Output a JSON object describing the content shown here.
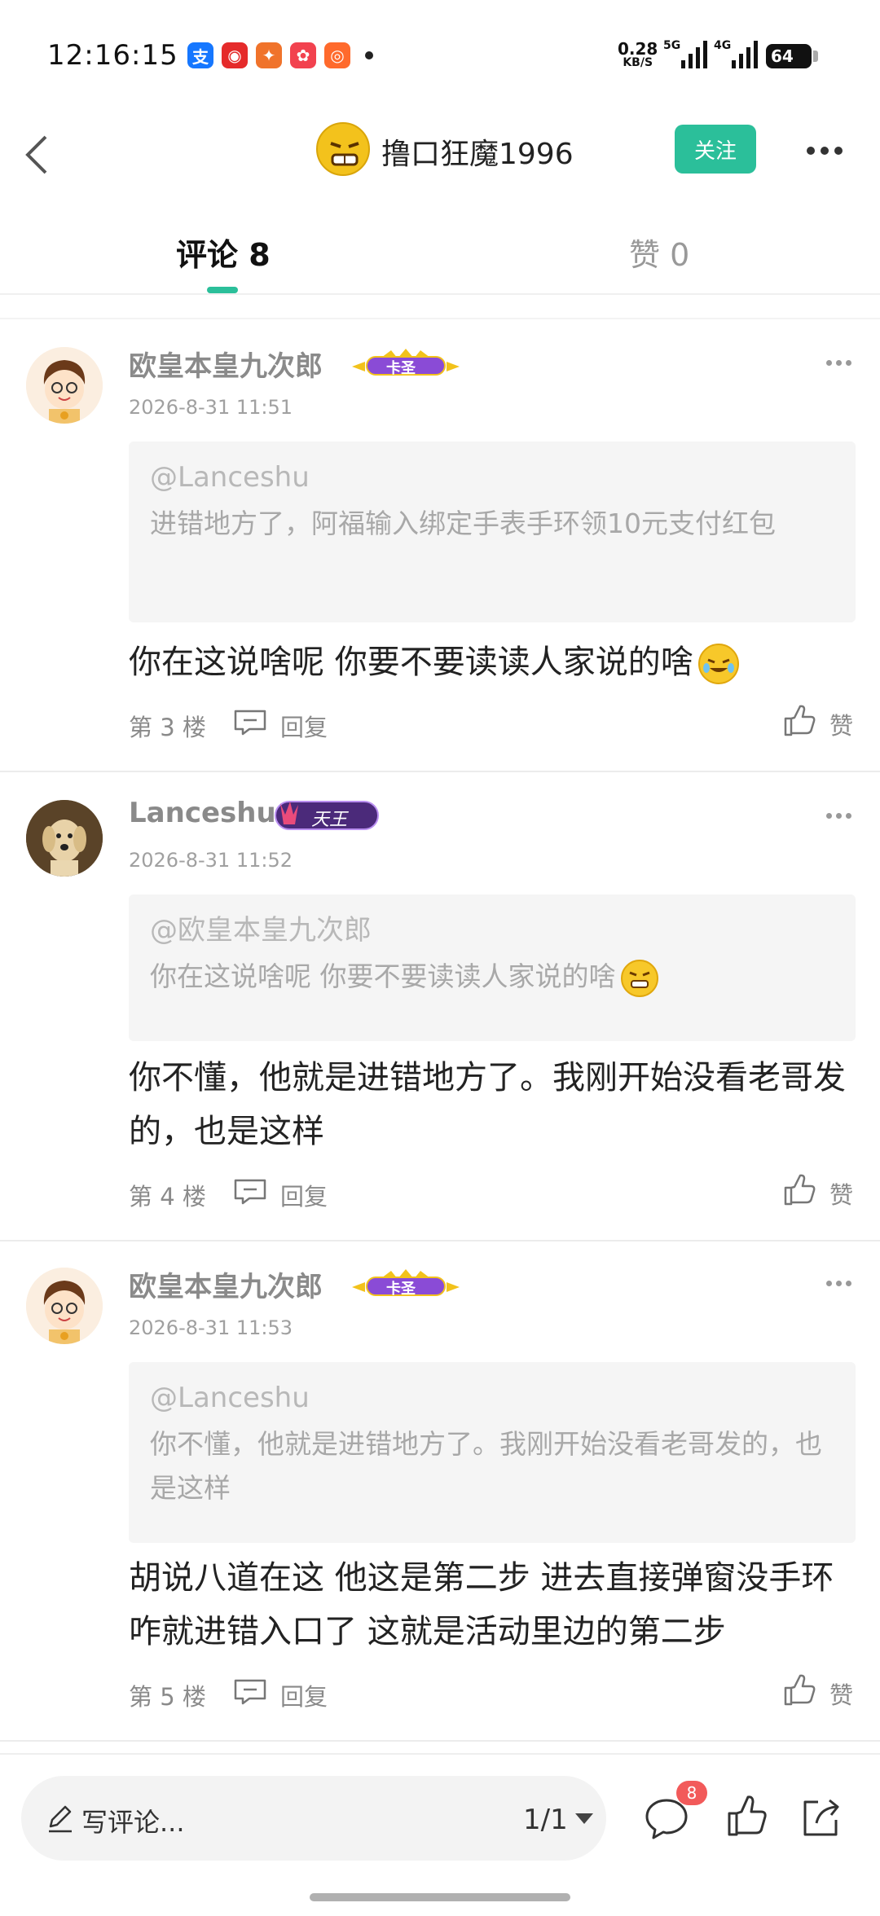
{
  "status_bar": {
    "time": "12:16:15",
    "net_speed_value": "0.28",
    "net_speed_unit": "KB/S",
    "signal_1_tag": "5G",
    "signal_2_tag": "4G",
    "battery": "64",
    "app_icons": [
      "alipay-icon",
      "bank-app-icon",
      "game-app-icon",
      "shopping-app-icon",
      "deals-app-icon"
    ]
  },
  "header": {
    "title": "撸口狂魔1996",
    "follow_label": "关注"
  },
  "tabs": [
    {
      "label": "评论 8"
    },
    {
      "label": "赞 0"
    }
  ],
  "comments": [
    {
      "user": "欧皇本皇九次郎",
      "badge": "卡圣",
      "time": "2026-8-31 11:51",
      "quote_at": "@Lanceshu",
      "quote_text": "进错地方了，阿福输入绑定手表手环领10元支付红包",
      "body": "你在这说啥呢 你要不要读读人家说的啥",
      "floor": "第 3 楼",
      "reply_label": "回复",
      "like_label": "赞"
    },
    {
      "user": "Lanceshu",
      "badge": "天王",
      "time": "2026-8-31 11:52",
      "quote_at": "@欧皇本皇九次郎",
      "quote_text": "你在这说啥呢 你要不要读读人家说的啥",
      "body": "你不懂，他就是进错地方了。我刚开始没看老哥发的，也是这样",
      "floor": "第 4 楼",
      "reply_label": "回复",
      "like_label": "赞"
    },
    {
      "user": "欧皇本皇九次郎",
      "badge": "卡圣",
      "time": "2026-8-31 11:53",
      "quote_at": "@Lanceshu",
      "quote_text": "你不懂，他就是进错地方了。我刚开始没看老哥发的，也是这样",
      "body": "胡说八道在这 他这是第二步 进去直接弹窗没手环 咋就进错入口了 这就是活动里边的第二步",
      "floor": "第 5 楼",
      "reply_label": "回复",
      "like_label": "赞"
    }
  ],
  "bottom_bar": {
    "write_placeholder": "写评论...",
    "pager": "1/1",
    "comment_count": "8"
  },
  "colors": {
    "accent": "#2bbf9a",
    "badge_red": "#f25a5a",
    "quote_bg": "#f5f5f5"
  }
}
